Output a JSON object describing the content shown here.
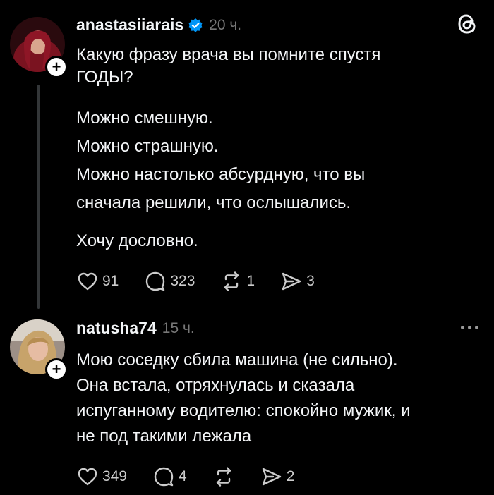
{
  "post1": {
    "username": "anastasiiarais",
    "time": "20 ч.",
    "text": {
      "line1": "Какую фразу врача вы помните спустя",
      "line2": "ГОДЫ?",
      "line3": "Можно смешную.",
      "line4": "Можно страшную.",
      "line5": "Можно настолько абсурдную, что вы",
      "line6": "сначала решили, что ослышались.",
      "line7": "Хочу дословно."
    },
    "likes": "91",
    "comments": "323",
    "reposts": "1",
    "shares": "3"
  },
  "post2": {
    "username": "natusha74",
    "time": "15 ч.",
    "text": {
      "line1": "Мою соседку сбила машина (не сильно).",
      "line2": "Она встала, отряхнулась и сказала",
      "line3": "испуганному водителю: спокойно мужик, и",
      "line4": "не под такими лежала"
    },
    "likes": "349",
    "comments": "4",
    "shares": "2"
  },
  "icons": {
    "follow": "plus-icon",
    "verified": "verified-badge-icon",
    "like": "heart-icon",
    "comment": "comment-bubble-icon",
    "repost": "repost-icon",
    "share": "send-icon",
    "brand": "threads-logo-icon",
    "menu": "more-icon"
  },
  "colors": {
    "background": "#000000",
    "text": "#f3f5f7",
    "muted": "#777777",
    "verified": "#0095f6"
  }
}
